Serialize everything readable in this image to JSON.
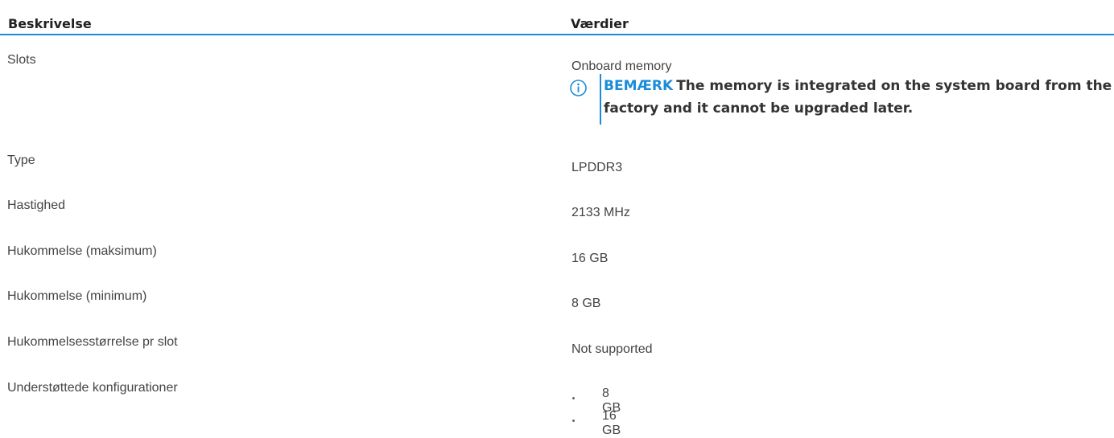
{
  "table": {
    "headers": {
      "description": "Beskrivelse",
      "values": "Værdier"
    },
    "rows": [
      {
        "description": "Slots",
        "value": "Onboard memory",
        "note": {
          "label": "BEMÆRK",
          "text": "The memory is integrated on the system board from the factory and it cannot be upgraded later."
        }
      },
      {
        "description": "Type",
        "value": "LPDDR3"
      },
      {
        "description": "Hastighed",
        "value": "2133 MHz"
      },
      {
        "description": "Hukommelse (maksimum)",
        "value": "16 GB"
      },
      {
        "description": "Hukommelse (minimum)",
        "value": "8 GB"
      },
      {
        "description": "Hukommelsesstørrelse pr slot",
        "value": "Not supported"
      },
      {
        "description": "Understøttede konfigurationer",
        "list": [
          "8 GB",
          "16 GB"
        ]
      }
    ]
  },
  "icons": {
    "note_icon": "info-circle-icon"
  },
  "colors": {
    "accent": "#1a8cd8",
    "text": "#444444",
    "header_text": "#222222"
  }
}
